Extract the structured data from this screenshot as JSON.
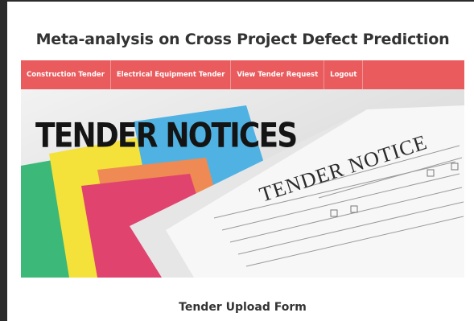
{
  "page": {
    "title": "Meta-analysis on Cross Project Defect Prediction"
  },
  "nav": {
    "items": [
      {
        "label": "Construction Tender"
      },
      {
        "label": "Electrical Equipment Tender"
      },
      {
        "label": "View Tender Request"
      },
      {
        "label": "Logout"
      }
    ],
    "background_color": "#e95b5d"
  },
  "banner": {
    "heading": "TENDER NOTICES",
    "paper_title": "TENDER NOTICE"
  },
  "form": {
    "title": "Tender Upload Form"
  }
}
